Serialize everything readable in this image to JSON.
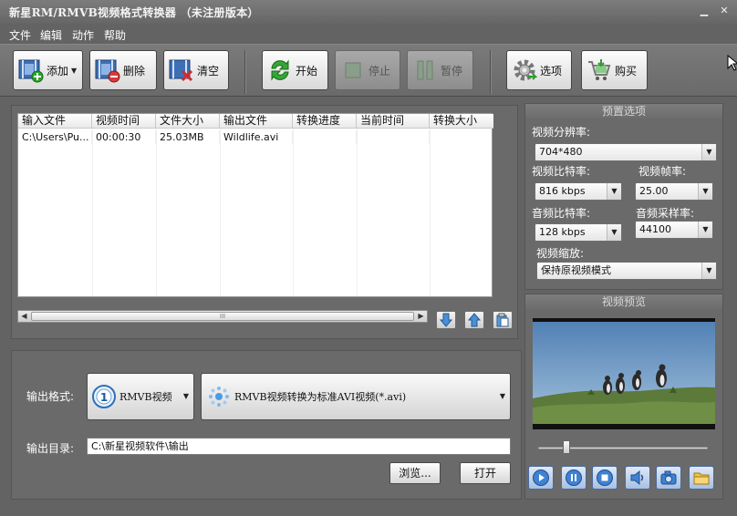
{
  "window": {
    "title": "新星RM/RMVB视频格式转换器 （未注册版本）",
    "controls": {
      "minimize": "▁",
      "close": "✕"
    }
  },
  "menu": [
    "文件",
    "编辑",
    "动作",
    "帮助"
  ],
  "toolbar": {
    "add": "添加",
    "delete": "删除",
    "clear": "清空",
    "start": "开始",
    "stop": "停止",
    "pause": "暂停",
    "options": "选项",
    "buy": "购买"
  },
  "file_table": {
    "columns": [
      "输入文件",
      "视频时间",
      "文件大小",
      "输出文件",
      "转换进度",
      "当前时间",
      "转换大小"
    ],
    "rows": [
      [
        "C:\\Users\\Pu...",
        "00:00:30",
        "25.03MB",
        "Wildlife.avi",
        "",
        "",
        ""
      ]
    ],
    "scroll_thumb": "III"
  },
  "output": {
    "format_label": "输出格式:",
    "format_category": "RMVB视频",
    "format_detail": "RMVB视频转换为标准AVI视频(*.avi)",
    "dir_label": "输出目录:",
    "dir_value": "C:\\新星视频软件\\输出",
    "browse": "浏览...",
    "open": "打开"
  },
  "presets": {
    "header": "预置选项",
    "resolution_label": "视频分辨率:",
    "resolution": "704*480",
    "video_bitrate_label": "视频比特率:",
    "video_bitrate": "816 kbps",
    "frame_rate_label": "视频帧率:",
    "frame_rate": "25.00",
    "audio_bitrate_label": "音频比特率:",
    "audio_bitrate": "128 kbps",
    "sample_rate_label": "音频采样率:",
    "sample_rate": "44100",
    "scale_label": "视频缩放:",
    "scale": "保持原视频模式"
  },
  "preview": {
    "header": "视频预览",
    "position_fraction": 0.15
  },
  "colors": {
    "background": "#636363",
    "button_blue": "#a9c0e0"
  }
}
